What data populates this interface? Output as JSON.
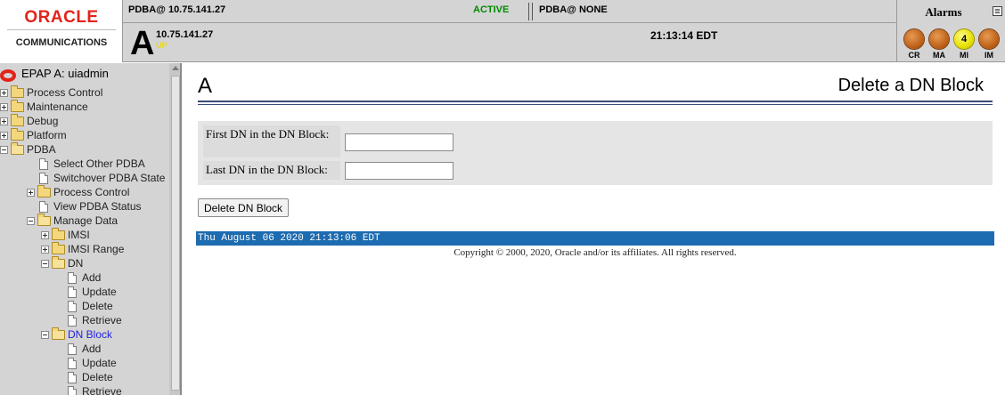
{
  "header": {
    "brand_name": "ORACLE",
    "brand_sub": "COMMUNICATIONS",
    "pdba_ip": "PDBA@ 10.75.141.27",
    "status": "ACTIVE",
    "pdba_none": "PDBA@ NONE",
    "host_letter": "A",
    "host_ip": "10.75.141.27",
    "host_state": "UP",
    "clock": "21:13:14 EDT"
  },
  "alarms": {
    "title": "Alarms",
    "menu_icon": "≣",
    "items": [
      {
        "label": "CR",
        "value": ""
      },
      {
        "label": "MA",
        "value": ""
      },
      {
        "label": "MI",
        "value": "4"
      },
      {
        "label": "IM",
        "value": ""
      }
    ],
    "colors": {
      "off": "#b85a12",
      "minor": "#e6e000"
    }
  },
  "sidebar": {
    "user": "EPAP A: uiadmin",
    "tree": [
      {
        "label": "Process Control"
      },
      {
        "label": "Maintenance"
      },
      {
        "label": "Debug"
      },
      {
        "label": "Platform"
      },
      {
        "label": "PDBA"
      },
      {
        "label": "Select Other PDBA"
      },
      {
        "label": "Switchover PDBA State"
      },
      {
        "label": "Process Control"
      },
      {
        "label": "View PDBA Status"
      },
      {
        "label": "Manage Data"
      },
      {
        "label": "IMSI"
      },
      {
        "label": "IMSI Range"
      },
      {
        "label": "DN"
      },
      {
        "label": "Add"
      },
      {
        "label": "Update"
      },
      {
        "label": "Delete"
      },
      {
        "label": "Retrieve"
      },
      {
        "label": "DN Block"
      },
      {
        "label": "Add"
      },
      {
        "label": "Update"
      },
      {
        "label": "Delete"
      },
      {
        "label": "Retrieve"
      }
    ]
  },
  "main": {
    "page_letter": "A",
    "page_title": "Delete a DN Block",
    "form": {
      "first_dn_label": "First DN in the DN Block:",
      "first_dn_value": "",
      "last_dn_label": "Last DN in the DN Block:",
      "last_dn_value": ""
    },
    "delete_button": "Delete DN Block",
    "timestamp": "Thu August 06 2020 21:13:06 EDT",
    "copyright": "Copyright © 2000, 2020, Oracle and/or its affiliates. All rights reserved."
  },
  "colors": {
    "brand_red": "#e2231a",
    "active_green": "#008a00",
    "status_bar_blue": "#1d6bb0",
    "selected_link": "#2222dd"
  }
}
